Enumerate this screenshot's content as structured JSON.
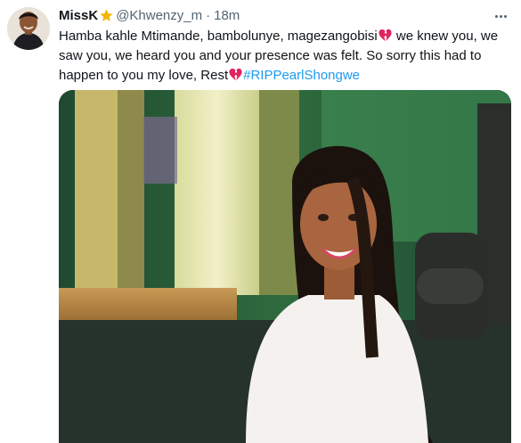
{
  "tweet": {
    "display_name": "MissK",
    "badge_icon": "star-emoji",
    "handle": "@Khwenzy_m",
    "separator": "·",
    "time": "18m",
    "text_lines": {
      "l1_a": "Hamba kahle Mtimande, bambolunye, magezangobisi",
      "l1_b": " we knew you, we",
      "l2": "saw you, we heard you and your presence was felt. So sorry this had to",
      "l3_a": "happen to you my love, Rest",
      "hashtag": "#RIPPearlShongwe"
    },
    "emoji": "broken-heart-icon",
    "colors": {
      "hashtag": "#1d9bf0",
      "secondary_text": "#536471",
      "heart": "#e0245e",
      "star": "#f4b400"
    }
  }
}
